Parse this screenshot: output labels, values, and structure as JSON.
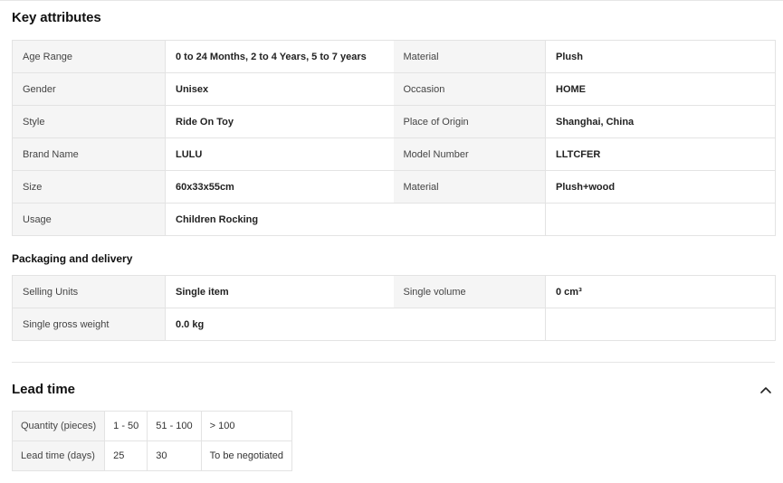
{
  "key_attributes": {
    "title": "Key attributes",
    "rows": [
      [
        {
          "k": "Age Range",
          "v": "0 to 24 Months, 2 to 4 Years, 5 to 7 years"
        },
        {
          "k": "Material",
          "v": "Plush"
        }
      ],
      [
        {
          "k": "Gender",
          "v": "Unisex"
        },
        {
          "k": "Occasion",
          "v": "HOME"
        }
      ],
      [
        {
          "k": "Style",
          "v": "Ride On Toy"
        },
        {
          "k": "Place of Origin",
          "v": "Shanghai, China"
        }
      ],
      [
        {
          "k": "Brand Name",
          "v": "LULU"
        },
        {
          "k": "Model Number",
          "v": "LLTCFER"
        }
      ],
      [
        {
          "k": "Size",
          "v": "60x33x55cm"
        },
        {
          "k": "Material",
          "v": "Plush+wood"
        }
      ],
      [
        {
          "k": "Usage",
          "v": "Children Rocking"
        }
      ]
    ]
  },
  "packaging": {
    "title": "Packaging and delivery",
    "rows": [
      [
        {
          "k": "Selling Units",
          "v": "Single item"
        },
        {
          "k": "Single volume",
          "v": "0 cm³"
        }
      ],
      [
        {
          "k": "Single gross weight",
          "v": "0.0 kg"
        }
      ]
    ]
  },
  "lead_time": {
    "title": "Lead time",
    "collapse_icon": "chevron-up-icon",
    "quantity_label": "Quantity (pieces)",
    "quantities": [
      "1 - 50",
      "51 - 100",
      "> 100"
    ],
    "days_label": "Lead time (days)",
    "days": [
      "25",
      "30",
      "To be negotiated"
    ]
  }
}
